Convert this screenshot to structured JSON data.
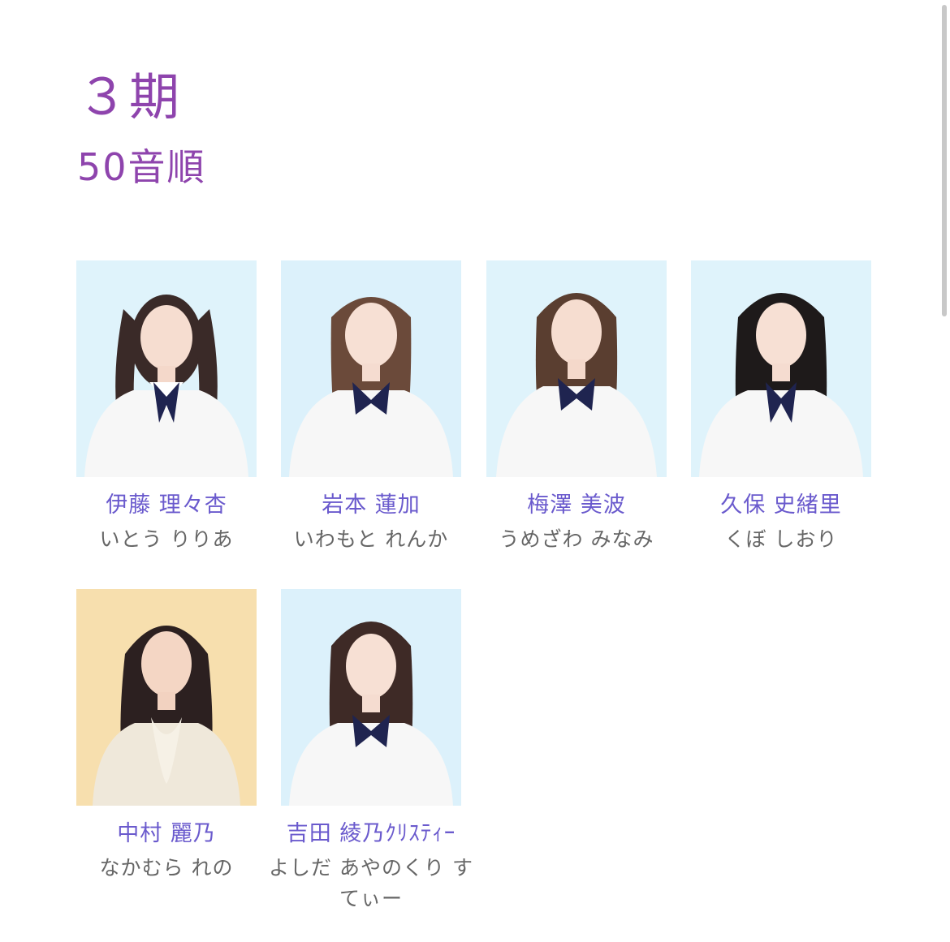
{
  "header": {
    "generation": "３期",
    "sort_order": "50音順"
  },
  "members": [
    {
      "name": "伊藤 理々杏",
      "kana": "いとう りりあ",
      "photo_bg": "#dff3fb"
    },
    {
      "name": "岩本 蓮加",
      "kana": "いわもと れんか",
      "photo_bg": "#dcf1fb"
    },
    {
      "name": "梅澤 美波",
      "kana": "うめざわ みなみ",
      "photo_bg": "#dff3fb"
    },
    {
      "name": "久保 史緒里",
      "kana": "くぼ しおり",
      "photo_bg": "#dff3fb"
    },
    {
      "name": "中村 麗乃",
      "kana": "なかむら れの",
      "photo_bg": "#f7dfae"
    },
    {
      "name": "吉田 綾乃ｸﾘｽﾃｨｰ",
      "kana": "よしだ あやのくり すてぃー",
      "photo_bg": "#dcf1fb"
    }
  ],
  "colors": {
    "heading": "#8e44ad",
    "name": "#6a5acd",
    "kana": "#666666"
  }
}
